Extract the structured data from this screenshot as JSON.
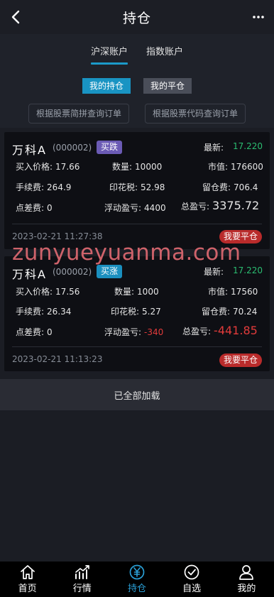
{
  "header": {
    "title": "持仓"
  },
  "account_tabs": [
    {
      "label": "沪深账户",
      "active": true
    },
    {
      "label": "指数账户",
      "active": false
    }
  ],
  "segments": [
    {
      "label": "我的持仓",
      "active": true
    },
    {
      "label": "我的平仓",
      "active": false
    }
  ],
  "query_buttons": [
    {
      "label": "根据股票简拼查询订单"
    },
    {
      "label": "根据股票代码查询订单"
    }
  ],
  "positions": [
    {
      "name": "万科A",
      "code": "(000002)",
      "direction": "买跌",
      "direction_type": "down",
      "latest_label": "最新:",
      "latest": "17.220",
      "buy_price_label": "买入价格:",
      "buy_price": "17.66",
      "qty_label": "数量:",
      "qty": "10000",
      "market_value_label": "市值:",
      "market_value": "176600",
      "fee_label": "手续费:",
      "fee": "264.9",
      "stamp_tax_label": "印花税:",
      "stamp_tax": "52.98",
      "overnight_fee_label": "留仓费:",
      "overnight_fee": "706.4",
      "spread_fee_label": "点差费:",
      "spread_fee": "0",
      "floating_pl_label": "浮动盈亏:",
      "floating_pl": "4400",
      "total_pl_label": "总盈亏:",
      "total_pl": "3375.72",
      "time": "2023-02-21 11:27:38",
      "close_label": "我要平仓"
    },
    {
      "name": "万科A",
      "code": "(000002)",
      "direction": "买涨",
      "direction_type": "up",
      "latest_label": "最新:",
      "latest": "17.220",
      "buy_price_label": "买入价格:",
      "buy_price": "17.56",
      "qty_label": "数量:",
      "qty": "1000",
      "market_value_label": "市值:",
      "market_value": "17560",
      "fee_label": "手续费:",
      "fee": "26.34",
      "stamp_tax_label": "印花税:",
      "stamp_tax": "5.27",
      "overnight_fee_label": "留仓费:",
      "overnight_fee": "70.24",
      "spread_fee_label": "点差费:",
      "spread_fee": "0",
      "floating_pl_label": "浮动盈亏:",
      "floating_pl": "-340",
      "total_pl_label": "总盈亏:",
      "total_pl": "-441.85",
      "time": "2023-02-21 11:13:23",
      "close_label": "我要平仓"
    }
  ],
  "footer_status": "已全部加载",
  "watermark": "zunyueyuanma.com",
  "tabbar": [
    {
      "label": "首页",
      "icon": "home-icon",
      "active": false
    },
    {
      "label": "行情",
      "icon": "chart-icon",
      "active": false
    },
    {
      "label": "持仓",
      "icon": "yen-icon",
      "active": true
    },
    {
      "label": "自选",
      "icon": "check-circle-icon",
      "active": false
    },
    {
      "label": "我的",
      "icon": "user-icon",
      "active": false
    }
  ],
  "colors": {
    "accent": "#1b9ac9",
    "positive": "#2bbd71",
    "negative": "#e23b3b",
    "close_button": "#b92b2b"
  }
}
